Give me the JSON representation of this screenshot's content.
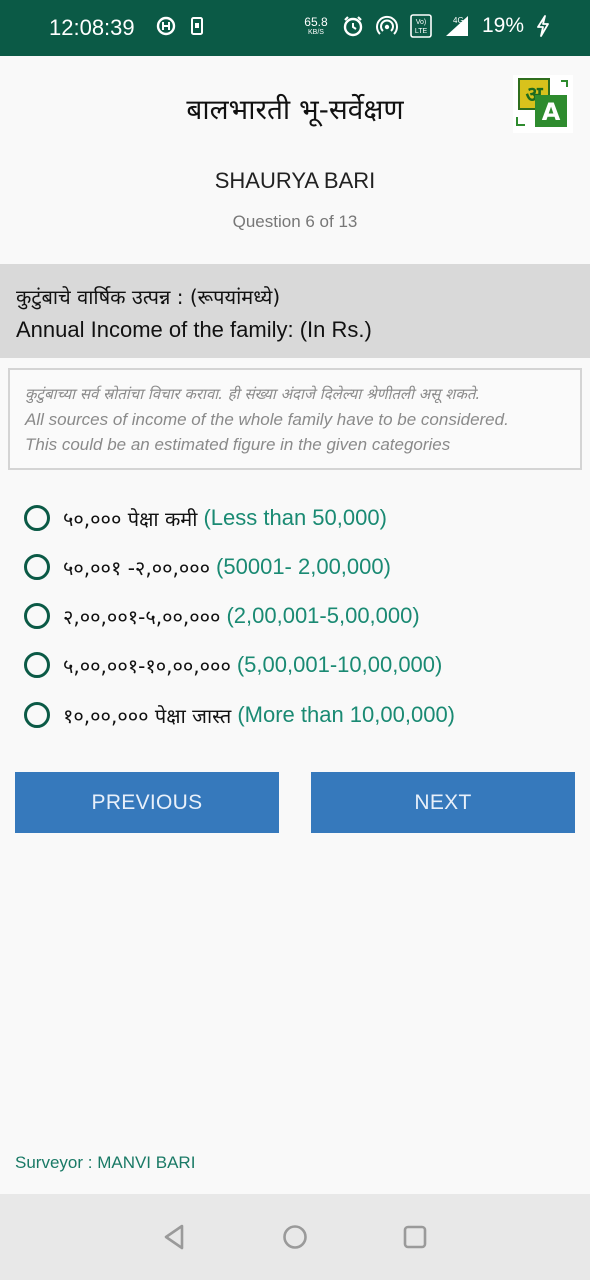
{
  "status_bar": {
    "time": "12:08:39",
    "net_speed_value": "65.8",
    "net_speed_unit": "KB/S",
    "volte_label_1": "Vo)",
    "volte_label_2": "LTE",
    "network_type": "4G",
    "battery_percent": "19%",
    "icons": [
      "sync-icon",
      "sim-card-icon",
      "alarm-icon",
      "hotspot-icon",
      "volte-icon",
      "signal-icon",
      "charging-icon"
    ]
  },
  "header": {
    "title": "बालभारती भू-सर्वेक्षण",
    "lang_glyph_mr": "अ",
    "lang_glyph_en": "A",
    "lang_icon": "translate-icon"
  },
  "respondent": {
    "name": "SHAURYA BARI",
    "question_progress": "Question 6 of 13"
  },
  "question": {
    "text_mr": "कुटुंबाचे वार्षिक उत्पन्न : (रूपयांमध्ये)",
    "text_en": "Annual Income of the family: (In Rs.)"
  },
  "hint": {
    "text_mr": "कुटुंबाच्या सर्व स्रोतांचा विचार करावा. ही संख्या अंदाजे दिलेल्या श्रेणीतली असू शकते.",
    "text_en_1": "All sources of income of the whole family have to be considered.",
    "text_en_2": "This could be an estimated figure in the given categories"
  },
  "options": [
    {
      "mr": "५०,००० पेक्षा कमी",
      "en": "(Less than 50,000)"
    },
    {
      "mr": "५०,००१ -२,००,०००",
      "en": "(50001- 2,00,000)"
    },
    {
      "mr": "२,००,००१-५,००,०००",
      "en": "(2,00,001-5,00,000)"
    },
    {
      "mr": "५,००,००१-१०,००,०००",
      "en": "(5,00,001-10,00,000)"
    },
    {
      "mr": "१०,००,००० पेक्षा जास्त",
      "en": "(More than 10,00,000)"
    }
  ],
  "buttons": {
    "previous": "PREVIOUS",
    "next": "NEXT"
  },
  "footer": {
    "surveyor": "Surveyor : MANVI BARI"
  },
  "android_nav": {
    "icons": [
      "back-icon",
      "home-icon",
      "recents-icon"
    ]
  },
  "colors": {
    "status_bar": "#0b5a46",
    "radio": "#0b5a46",
    "option_english": "#1a8a73",
    "button": "#3679bc",
    "surveyor": "#1a7a66",
    "question_bg": "#d9d9d9"
  }
}
